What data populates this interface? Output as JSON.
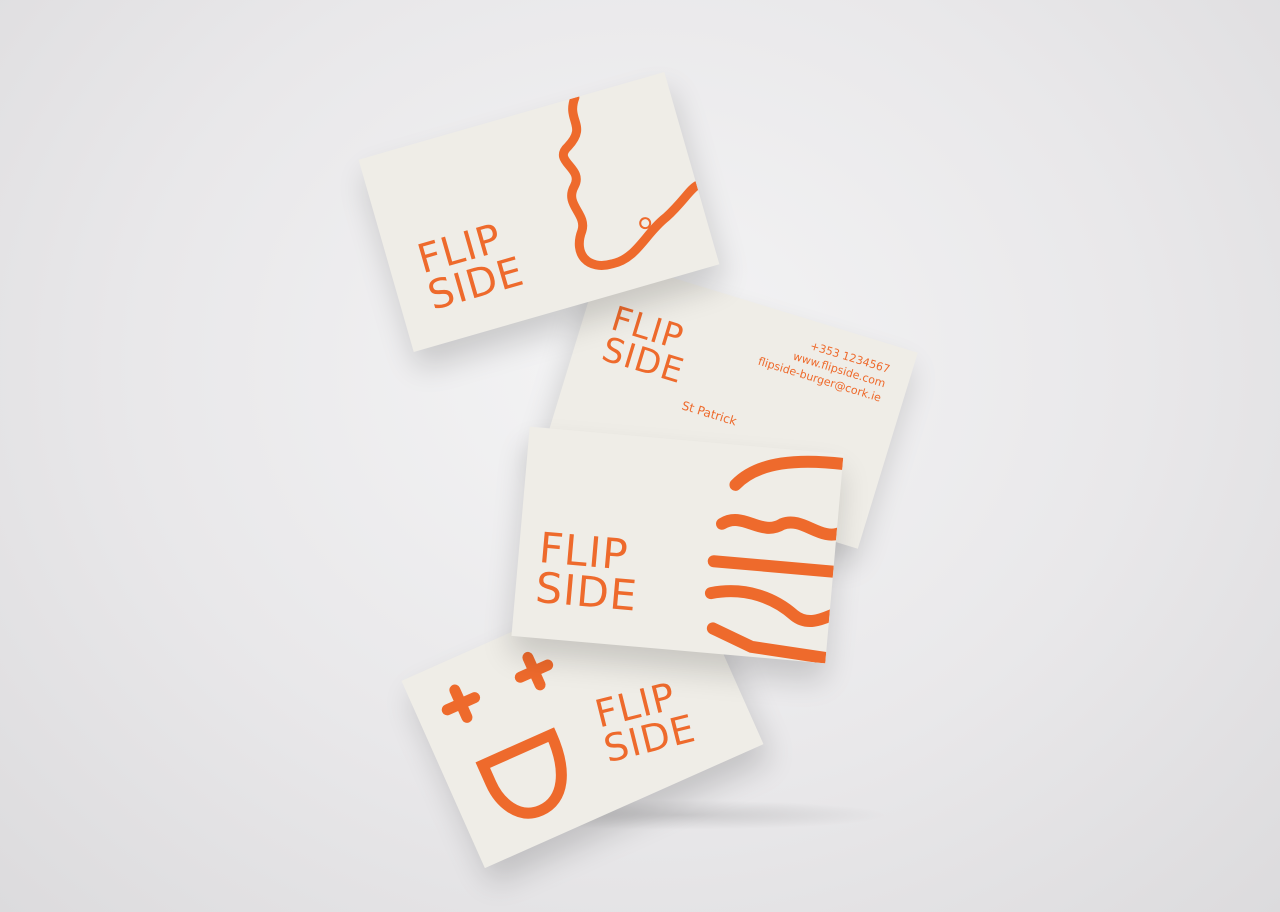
{
  "brand": {
    "line1": "FLIP",
    "line2": "SIDE",
    "color": "#ee6a2c"
  },
  "back_card": {
    "phone": "+353 1234567",
    "website": "www.flipside.com",
    "email": "flipside-burger@cork.ie",
    "address_partial": "St Patrick"
  },
  "graphics": [
    "map-route-icon",
    "burger-icon",
    "smiley-face-icon"
  ]
}
